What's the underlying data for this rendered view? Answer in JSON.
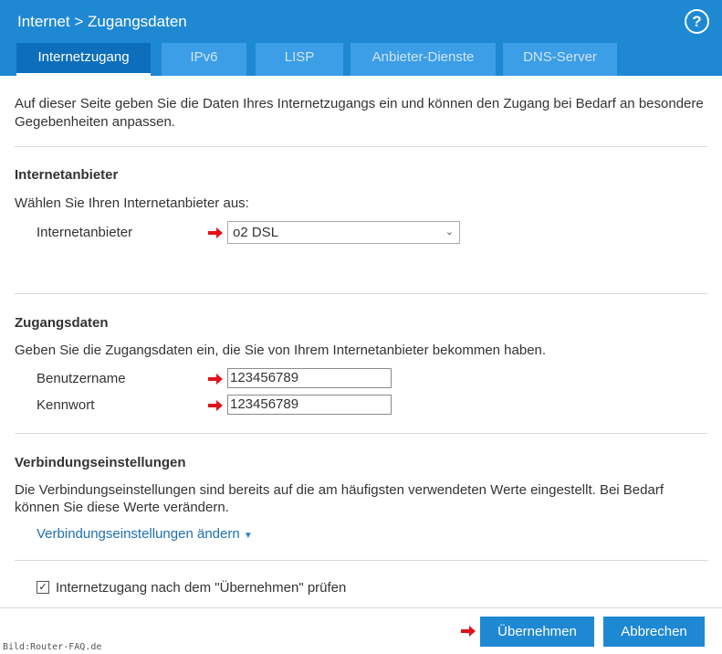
{
  "header": {
    "breadcrumb": "Internet > Zugangsdaten",
    "help_icon": "?",
    "tabs": [
      {
        "label": "Internetzugang",
        "active": true
      },
      {
        "label": "IPv6",
        "active": false
      },
      {
        "label": "LISP",
        "active": false
      },
      {
        "label": "Anbieter-Dienste",
        "active": false
      },
      {
        "label": "DNS-Server",
        "active": false
      }
    ]
  },
  "intro": {
    "line1": "Auf dieser Seite geben Sie die Daten Ihres Internetzugangs ein und können den Zugang bei Bedarf an besondere",
    "line2": "Gegebenheiten anpassen."
  },
  "provider": {
    "heading": "Internetanbieter",
    "prompt": "Wählen Sie Ihren Internetanbieter aus:",
    "label": "Internetanbieter",
    "selected": "o2 DSL"
  },
  "credentials": {
    "heading": "Zugangsdaten",
    "prompt": "Geben Sie die Zugangsdaten ein, die Sie von Ihrem Internetanbieter bekommen haben.",
    "username_label": "Benutzername",
    "username_value": "123456789",
    "password_label": "Kennwort",
    "password_value": "123456789"
  },
  "connection": {
    "heading": "Verbindungseinstellungen",
    "line1": "Die Verbindungseinstellungen sind bereits auf die am häufigsten verwendeten Werte eingestellt. Bei Bedarf",
    "line2": "können Sie diese Werte verändern.",
    "link": "Verbindungseinstellungen ändern",
    "caret": "▼"
  },
  "check": {
    "checked_mark": "✓",
    "label": "Internetzugang nach dem \"Übernehmen\" prüfen"
  },
  "footer": {
    "apply": "Übernehmen",
    "cancel": "Abbrechen",
    "credit": "Bild:Router-FAQ.de"
  },
  "colors": {
    "header_blue": "#1e88d3",
    "active_tab": "#0d6fbc",
    "arrow_red": "#e0131a"
  }
}
